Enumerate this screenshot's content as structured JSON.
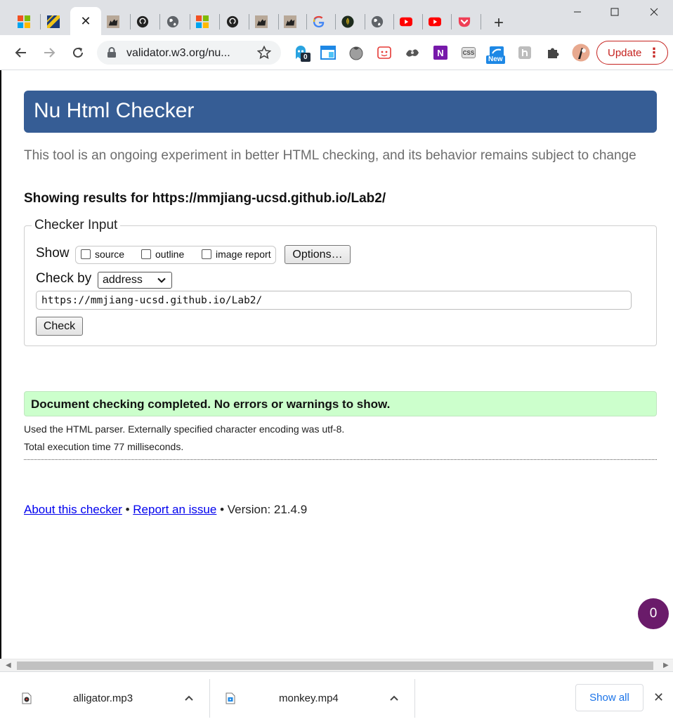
{
  "browser": {
    "tabs": [
      {
        "icon": "microsoft-icon"
      },
      {
        "icon": "stripes-icon"
      },
      {
        "icon": "close-icon",
        "active": true
      },
      {
        "icon": "cat-icon"
      },
      {
        "icon": "github-icon"
      },
      {
        "icon": "globe-icon"
      },
      {
        "icon": "microsoft-icon"
      },
      {
        "icon": "github-icon"
      },
      {
        "icon": "cat-icon"
      },
      {
        "icon": "cat-icon"
      },
      {
        "icon": "google-icon"
      },
      {
        "icon": "leaf-icon"
      },
      {
        "icon": "globe-icon"
      },
      {
        "icon": "youtube-icon"
      },
      {
        "icon": "youtube-icon"
      },
      {
        "icon": "pocket-icon"
      }
    ],
    "new_tab_label": "+",
    "window_controls": {
      "minimize": "—",
      "maximize": "☐",
      "close": "✕"
    },
    "address_bar": {
      "url": "validator.w3.org/nu..."
    },
    "extensions": [
      {
        "icon": "ghost-icon",
        "badge": "0"
      },
      {
        "icon": "window-icon"
      },
      {
        "icon": "tomato-icon"
      },
      {
        "icon": "face-icon"
      },
      {
        "icon": "bird-icon"
      },
      {
        "icon": "onenote-icon",
        "text": "N"
      },
      {
        "icon": "css-icon",
        "text": "CSS"
      },
      {
        "icon": "new-icon",
        "badge": "New"
      },
      {
        "icon": "script-icon"
      },
      {
        "icon": "puzzle-icon"
      },
      {
        "icon": "profile-avatar"
      }
    ],
    "update_label": "Update",
    "update_menu": "⋮"
  },
  "page": {
    "title": "Nu Html Checker",
    "lead": "This tool is an ongoing experiment in better HTML checking, and its behavior remains subject to change",
    "showing": "Showing results for https://mmjiang-ucsd.github.io/Lab2/",
    "checker": {
      "legend": "Checker Input",
      "show_label": "Show",
      "options": [
        {
          "label": "source",
          "checked": false
        },
        {
          "label": "outline",
          "checked": false
        },
        {
          "label": "image report",
          "checked": false
        }
      ],
      "options_button": "Options…",
      "check_by_label": "Check by",
      "check_by_value": "address",
      "url_value": "https://mmjiang-ucsd.github.io/Lab2/",
      "check_button": "Check"
    },
    "result": "Document checking completed. No errors or warnings to show.",
    "parser_info": "Used the HTML parser. Externally specified character encoding was utf-8.",
    "execution_time": "Total execution time 77 milliseconds.",
    "footer": {
      "about": "About this checker",
      "sep1": " • ",
      "report": "Report an issue",
      "sep2": " • ",
      "version": "Version: 21.4.9"
    },
    "bubble_count": "0"
  },
  "downloads": {
    "items": [
      {
        "name": "alligator.mp3",
        "icon": "audio-file-icon"
      },
      {
        "name": "monkey.mp4",
        "icon": "video-file-icon"
      }
    ],
    "show_all": "Show all",
    "close": "✕"
  },
  "colors": {
    "header_bg": "#365d95",
    "success_bg": "#ccffcc",
    "update_red": "#c5221f",
    "link_blue": "#0000ee",
    "bubble_purple": "#6a1b6a"
  }
}
